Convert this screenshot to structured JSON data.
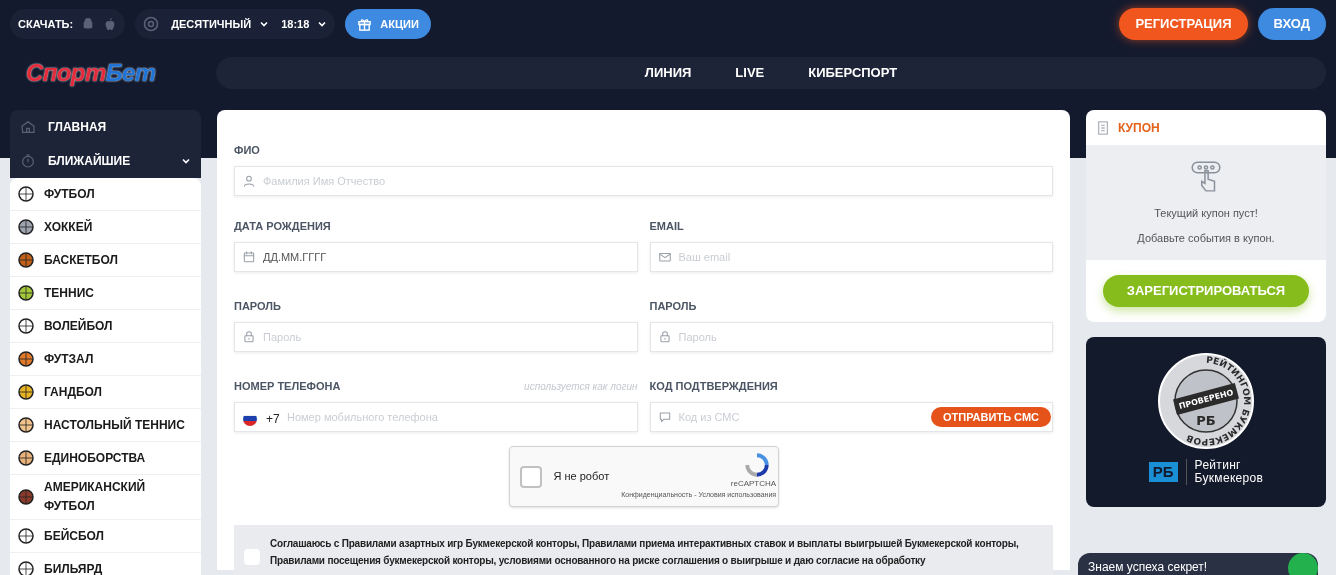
{
  "topbar": {
    "download_label": "СКАЧАТЬ:",
    "odds_format": "ДЕСЯТИЧНЫЙ",
    "time": "18:18",
    "promo": "АКЦИИ",
    "register": "РЕГИСТРАЦИЯ",
    "login": "ВХОД"
  },
  "logo": {
    "part1": "Спорт",
    "part2": "Бет"
  },
  "nav": [
    {
      "label": "ЛИНИЯ",
      "selected": false
    },
    {
      "label": "LIVE",
      "selected": false
    },
    {
      "label": "КИБЕРСПОРТ",
      "selected": false
    }
  ],
  "sidebar": {
    "main": [
      {
        "label": "ГЛАВНАЯ",
        "kind": "home"
      },
      {
        "label": "БЛИЖАЙШИЕ",
        "kind": "timer",
        "expanded": true
      }
    ],
    "sports": [
      {
        "label": "ФУТБОЛ"
      },
      {
        "label": "ХОККЕЙ"
      },
      {
        "label": "БАСКЕТБОЛ"
      },
      {
        "label": "ТЕННИС"
      },
      {
        "label": "ВОЛЕЙБОЛ"
      },
      {
        "label": "ФУТЗАЛ"
      },
      {
        "label": "ГАНДБОЛ"
      },
      {
        "label": "НАСТОЛЬНЫЙ ТЕННИС"
      },
      {
        "label": "ЕДИНОБОРСТВА"
      },
      {
        "label": "АМЕРИКАНСКИЙ ФУТБОЛ"
      },
      {
        "label": "БЕЙСБОЛ"
      },
      {
        "label": "БИЛЬЯРД"
      }
    ]
  },
  "form": {
    "rows": [
      [
        {
          "label": "ФИО",
          "placeholder": "Фамилия Имя Отчество"
        }
      ],
      [
        {
          "label": "ДАТА РОЖДЕНИЯ",
          "placeholder": "ДД.ММ.ГГГГ"
        },
        {
          "label": "EMAIL",
          "placeholder": "Ваш email"
        }
      ],
      [
        {
          "label": "ПАРОЛЬ",
          "placeholder": "Пароль"
        },
        {
          "label": "ПАРОЛЬ",
          "placeholder": "Пароль"
        }
      ],
      [
        {
          "label": "НОМЕР ТЕЛЕФОНА",
          "hint": "используется как логин",
          "prefix": "+7",
          "placeholder": "Номер мобильного телефона"
        },
        {
          "label": "КОД ПОДТВЕРЖДЕНИЯ",
          "placeholder": "Код из СМС",
          "button": "ОТПРАВИТЬ СМС"
        }
      ]
    ],
    "captcha": {
      "label": "Я не робот",
      "checked": false,
      "brand": "reCAPTCHA",
      "links": "Конфиденциальность - Условия использования"
    },
    "consent": {
      "checked": false,
      "text": "Соглашаюсь с Правилами азартных игр Букмекерской конторы, Правилами приема интерактивных ставок и выплаты выигрышей Букмекерской конторы, Правилами посещения букмекерской конторы, условиями основанного на риске соглашения о выигрыше и даю согласие на обработку"
    }
  },
  "coupon": {
    "title": "КУПОН",
    "empty_line1": "Текущий купон пуст!",
    "empty_line2": "Добавьте события в купон.",
    "button": "ЗАРЕГИСТРИРОВАТЬСЯ"
  },
  "rating_banner": {
    "ring_text": "РЕЙТИНГОМ БУКМЕКЕРОВ",
    "stamp": "ПРОВЕРЕНО",
    "stamp_logo": "РБ",
    "logo_mark": "РБ",
    "line1": "Рейтинг",
    "line2": "Букмекеров"
  },
  "chat": {
    "text": "Знаем успеха секрет!"
  }
}
